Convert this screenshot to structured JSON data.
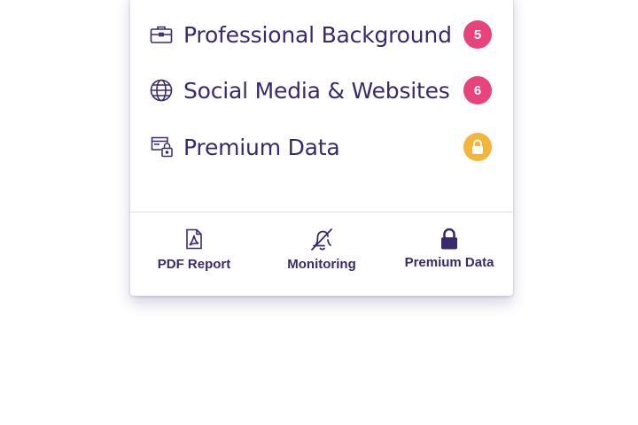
{
  "menu": {
    "items": [
      {
        "label": "Professional Background",
        "icon": "briefcase-icon",
        "badge": "5",
        "badge_color": "#e8437a"
      },
      {
        "label": "Social Media & Websites",
        "icon": "globe-icon",
        "badge": "6",
        "badge_color": "#e8437a"
      },
      {
        "label": "Premium Data",
        "icon": "locked-card-icon",
        "badge_icon": "lock-icon",
        "badge_color": "#f3b53a"
      }
    ]
  },
  "footer": {
    "pdf_label": "PDF Report",
    "monitoring_label": "Monitoring",
    "premium_label": "Premium Data"
  },
  "colors": {
    "text": "#3b2a6b",
    "badge_pink": "#e8437a",
    "badge_yellow": "#f3b53a",
    "divider": "#dcdce0"
  }
}
